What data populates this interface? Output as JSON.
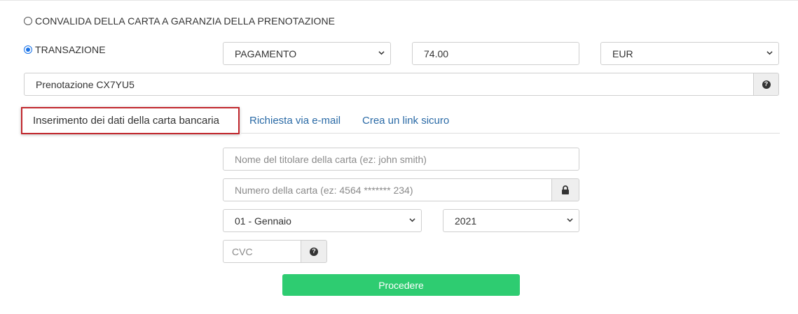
{
  "mode_options": {
    "validate_card_label": "CONVALIDA DELLA CARTA A GARANZIA DELLA PRENOTAZIONE",
    "transaction_label": "TRANSAZIONE",
    "selected": "transaction"
  },
  "transaction": {
    "type_value": "PAGAMENTO",
    "amount_value": "74.00",
    "currency_value": "EUR"
  },
  "reference": {
    "value": "Prenotazione CX7YU5",
    "help_icon": "question-circle-icon"
  },
  "tabs": [
    {
      "label": "Inserimento dei dati della carta bancaria",
      "active": true
    },
    {
      "label": "Richiesta via e-mail",
      "active": false
    },
    {
      "label": "Crea un link sicuro",
      "active": false
    }
  ],
  "card_form": {
    "holder_placeholder": "Nome del titolare della carta (ez: john smith)",
    "number_placeholder": "Numero della carta (ez: 4564 ******* 234)",
    "lock_icon": "lock-icon",
    "month_value": "01 - Gennaio",
    "year_value": "2021",
    "cvc_placeholder": "CVC",
    "cvc_help_icon": "question-circle-icon"
  },
  "proceed_label": "Procedere",
  "colors": {
    "accent_blue": "#2a6aa6",
    "highlight_red": "#c1272d",
    "proceed_green": "#2ecc71"
  }
}
